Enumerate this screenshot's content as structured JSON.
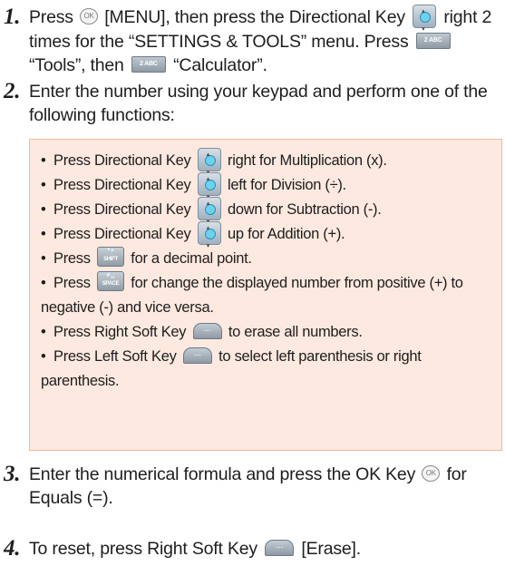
{
  "steps": [
    {
      "number": "1.",
      "t1": "Press",
      "t2": "[MENU], then press the Directional Key",
      "t3": "right 2 times for the “SETTINGS & TOOLS” menu. Press",
      "t4": "“Tools”, then",
      "t5": "“Calculator”."
    },
    {
      "number": "2.",
      "t1": "Enter the number using your keypad and perform one of the following functions:"
    },
    {
      "number": "3.",
      "t1": "Enter the numerical formula and press the OK Key",
      "t2": "for Equals (=)."
    },
    {
      "number": "4.",
      "t1": "To reset, press Right Soft Key",
      "t2": "[Erase]."
    }
  ],
  "bullets": [
    {
      "a": "Press Directional Key",
      "b": "right for Multiplication (x)."
    },
    {
      "a": "Press Directional Key",
      "b": "left for Division (÷)."
    },
    {
      "a": "Press Directional Key",
      "b": "down for Subtraction (-)."
    },
    {
      "a": "Press Directional Key",
      "b": "up for Addition (+)."
    },
    {
      "a": "Press",
      "b": "for a decimal point."
    },
    {
      "a": "Press",
      "b": "for change the displayed number from positive (+) to",
      "c": "negative (-) and vice versa."
    },
    {
      "a": "Press Right Soft Key",
      "b": "to erase all numbers."
    },
    {
      "a": "Press Left Soft Key",
      "b": "to select left parenthesis or right",
      "c": "parenthesis."
    }
  ],
  "bullet_char": "•",
  "icons": {
    "ok": "OK",
    "key2": "2 ABC",
    "key_star": "* +",
    "key_star_sub": "SHIFT",
    "key_pound": "# ␣",
    "key_pound_sub": "SPACE",
    "soft": "..."
  }
}
